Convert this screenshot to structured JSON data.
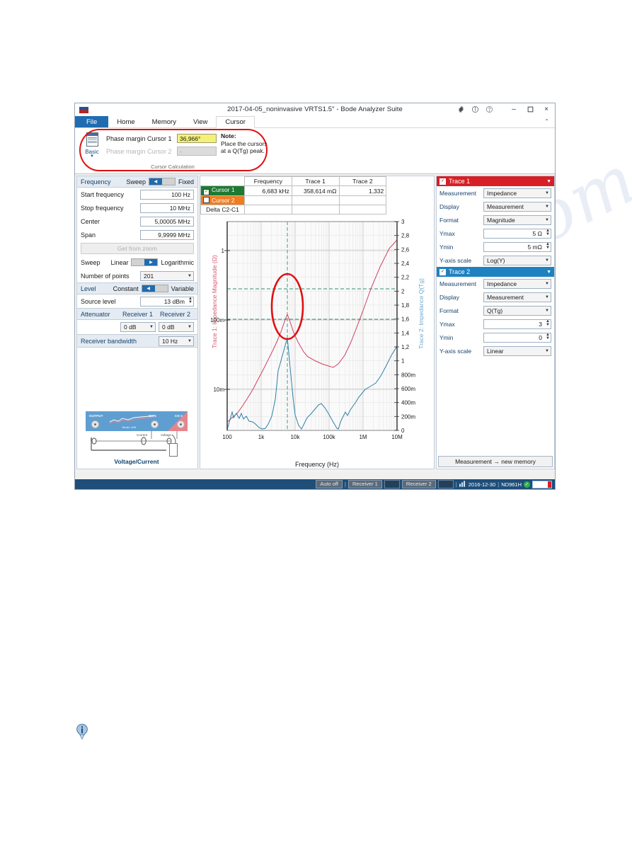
{
  "window": {
    "title": "2017-04-05_noninvasive VRTS1.5\" - Bode Analyzer Suite",
    "icons": {
      "settings": "gear-icon",
      "info": "info-circle-icon",
      "help": "help-circle-icon",
      "minimize": "–",
      "maximize": "❑",
      "close": "×",
      "collapse_ribbon": "⌃"
    }
  },
  "ribbon": {
    "tabs": [
      {
        "label": "File",
        "active": false,
        "style": "file"
      },
      {
        "label": "Home",
        "active": false
      },
      {
        "label": "Memory",
        "active": false
      },
      {
        "label": "View",
        "active": false
      },
      {
        "label": "Cursor",
        "active": true
      }
    ],
    "group": {
      "caption": "Cursor Calculation",
      "basic_label": "Basic",
      "rows": [
        {
          "label": "Phase margin Cursor 1",
          "value": "36,966°",
          "enabled": true
        },
        {
          "label": "Phase margin Cursor 2",
          "value": "-",
          "enabled": false
        }
      ],
      "note_title": "Note:",
      "note_lines": [
        "Place the cursors",
        "at a Q(Tg) peak."
      ]
    }
  },
  "left_panel": {
    "frequency": {
      "title": "Frequency",
      "toggle_left": "Sweep",
      "toggle_right": "Fixed",
      "toggle_position": "left"
    },
    "fields": [
      {
        "label": "Start frequency",
        "value": "100 Hz"
      },
      {
        "label": "Stop frequency",
        "value": "10 MHz"
      },
      {
        "label": "Center",
        "value": "5,00005 MHz"
      },
      {
        "label": "Span",
        "value": "9,9999 MHz"
      }
    ],
    "get_from_zoom": "Get from zoom",
    "sweep": {
      "label": "Sweep",
      "toggle_left": "Linear",
      "toggle_right": "Logarithmic",
      "toggle_position": "right"
    },
    "number_of_points": {
      "label": "Number of points",
      "value": "201"
    },
    "level": {
      "title": "Level",
      "toggle_left": "Constant",
      "toggle_right": "Variable",
      "toggle_position": "left"
    },
    "source_level": {
      "label": "Source level",
      "value": "13 dBm"
    },
    "attenuator": {
      "title": "Attenuator",
      "col1": "Receiver 1",
      "col2": "Receiver 2",
      "value1": "0 dB",
      "value2": "0 dB"
    },
    "receiver_bandwidth": {
      "label": "Receiver bandwidth",
      "value": "10 Hz"
    },
    "circuit": {
      "caption": "Voltage/Current",
      "ports": [
        "OUTPUT",
        "CH 1",
        "CH 2"
      ],
      "brand": "Bode 100",
      "labels": [
        "Current",
        "Voltage"
      ],
      "dut": "DUT"
    }
  },
  "cursor_table": {
    "headers": [
      "",
      "Frequency",
      "Trace 1",
      "Trace 2"
    ],
    "rows": [
      {
        "name": "Cursor 1",
        "checked": true,
        "frequency": "6,683 kHz",
        "trace1": "358,614 mΩ",
        "trace2": "1,332"
      },
      {
        "name": "Cursor 2",
        "checked": false,
        "frequency": "",
        "trace1": "",
        "trace2": ""
      },
      {
        "name": "Delta C2-C1",
        "checked": null,
        "frequency": "",
        "trace1": "",
        "trace2": ""
      }
    ]
  },
  "right_panel": {
    "trace1": {
      "title": "Trace 1",
      "color": "#d81f26",
      "rows": [
        {
          "label": "Measurement",
          "value": "Impedance",
          "type": "combo"
        },
        {
          "label": "Display",
          "value": "Measurement",
          "type": "combo"
        },
        {
          "label": "Format",
          "value": "Magnitude",
          "type": "combo"
        },
        {
          "label": "Ymax",
          "value": "5 Ω",
          "type": "spin"
        },
        {
          "label": "Ymin",
          "value": "5 mΩ",
          "type": "spin"
        },
        {
          "label": "Y-axis scale",
          "value": "Log(Y)",
          "type": "combo"
        }
      ]
    },
    "trace2": {
      "title": "Trace 2",
      "color": "#1f82c0",
      "rows": [
        {
          "label": "Measurement",
          "value": "Impedance",
          "type": "combo"
        },
        {
          "label": "Display",
          "value": "Measurement",
          "type": "combo"
        },
        {
          "label": "Format",
          "value": "Q(Tg)",
          "type": "combo"
        },
        {
          "label": "Ymax",
          "value": "3",
          "type": "spin"
        },
        {
          "label": "Ymin",
          "value": "0",
          "type": "spin"
        },
        {
          "label": "Y-axis scale",
          "value": "Linear",
          "type": "combo"
        }
      ]
    },
    "memory_button": "Measurement → new memory"
  },
  "statusbar": {
    "auto_off": "Auto off",
    "receiver1": "Receiver 1",
    "receiver2": "Receiver 2",
    "date": "2016-12-30",
    "device": "ND961H",
    "check": "✓",
    "chart_icon": "bar-chart-icon"
  },
  "chart_data": {
    "type": "line",
    "title": "",
    "xlabel": "Frequency (Hz)",
    "ylabel": "Trace 1: Impedance Magnitude (Ω)",
    "ylabel_right": "Trace 2: Impedance Q(Tg)",
    "xscale": "log",
    "xlim": [
      100,
      10000000
    ],
    "xticks": [
      100,
      1000,
      10000,
      100000,
      1000000,
      10000000
    ],
    "xticklabels": [
      "100",
      "1k",
      "10k",
      "100k",
      "1M",
      "10M"
    ],
    "left_axis": {
      "scale": "log",
      "ylim": [
        0.005,
        5
      ],
      "ticks": [
        0.01,
        0.1,
        1
      ],
      "ticklabels": [
        "10m",
        "100m",
        "1"
      ],
      "color": "#d4566f"
    },
    "right_axis": {
      "scale": "linear",
      "ylim": [
        0,
        3
      ],
      "ticks": [
        0,
        0.2,
        0.4,
        0.6,
        0.8,
        1,
        1.2,
        1.4,
        1.6,
        1.8,
        2,
        2.2,
        2.4,
        2.6,
        2.8,
        3
      ],
      "ticklabels": [
        "0",
        "200m",
        "400m",
        "600m",
        "800m",
        "1",
        "1,2",
        "1,4",
        "1,6",
        "1,8",
        "2",
        "2,2",
        "2,4",
        "2,6",
        "2,8",
        "3"
      ],
      "color": "#6aa7cf"
    },
    "grid": true,
    "legend": "none",
    "cursor_lines": {
      "vertical_x": 6683,
      "horizontal_left_y": 0.358614,
      "horizontal_right_y": 1.332,
      "color": "#2f8f6f"
    },
    "annotation": {
      "type": "ellipse",
      "color": "#e01010",
      "center_x": 7000,
      "note": "highlight of Q(Tg) peak and magnitude peak"
    },
    "series": [
      {
        "name": "Trace 1: Impedance Magnitude",
        "axis": "left",
        "color": "#cf4060",
        "points": [
          [
            100,
            0.0062
          ],
          [
            140,
            0.0075
          ],
          [
            200,
            0.0088
          ],
          [
            300,
            0.0115
          ],
          [
            450,
            0.0155
          ],
          [
            700,
            0.0225
          ],
          [
            1000,
            0.0315
          ],
          [
            1500,
            0.048
          ],
          [
            2200,
            0.071
          ],
          [
            3200,
            0.105
          ],
          [
            4500,
            0.158
          ],
          [
            5500,
            0.22
          ],
          [
            6200,
            0.29
          ],
          [
            6683,
            0.359
          ],
          [
            7200,
            0.3
          ],
          [
            8200,
            0.215
          ],
          [
            10000,
            0.155
          ],
          [
            14000,
            0.112
          ],
          [
            20000,
            0.093
          ],
          [
            40000,
            0.078
          ],
          [
            80000,
            0.072
          ],
          [
            150000,
            0.068
          ],
          [
            250000,
            0.066
          ],
          [
            400000,
            0.072
          ],
          [
            700000,
            0.1
          ],
          [
            1200000,
            0.17
          ],
          [
            2000000,
            0.3
          ],
          [
            3500000,
            0.62
          ],
          [
            6000000,
            1.25
          ],
          [
            10000000,
            2.2
          ]
        ]
      },
      {
        "name": "Trace 2: Impedance Q(Tg)",
        "axis": "right",
        "color": "#2e7fa8",
        "points": [
          [
            100,
            0.01
          ],
          [
            120,
            0.12
          ],
          [
            150,
            0.26
          ],
          [
            180,
            0.18
          ],
          [
            220,
            0.25
          ],
          [
            280,
            0.17
          ],
          [
            330,
            0.24
          ],
          [
            400,
            0.16
          ],
          [
            500,
            0.2
          ],
          [
            650,
            0.13
          ],
          [
            850,
            0.12
          ],
          [
            1100,
            0.09
          ],
          [
            1500,
            0.04
          ],
          [
            2000,
            0.02
          ],
          [
            2600,
            0.03
          ],
          [
            3300,
            0.09
          ],
          [
            4200,
            0.2
          ],
          [
            5200,
            0.45
          ],
          [
            6000,
            0.85
          ],
          [
            6683,
            1.332
          ],
          [
            7400,
            0.9
          ],
          [
            8500,
            0.48
          ],
          [
            10000,
            0.22
          ],
          [
            13000,
            0.07
          ],
          [
            17000,
            0.02
          ],
          [
            22000,
            0.1
          ],
          [
            30000,
            0.18
          ],
          [
            45000,
            0.24
          ],
          [
            70000,
            0.31
          ],
          [
            110000,
            0.38
          ],
          [
            160000,
            0.39
          ],
          [
            250000,
            0.33
          ],
          [
            400000,
            0.24
          ],
          [
            600000,
            0.14
          ],
          [
            900000,
            0.03
          ],
          [
            1100000,
            0.02
          ],
          [
            1500000,
            0.14
          ],
          [
            2200000,
            0.26
          ],
          [
            2800000,
            0.22
          ],
          [
            3500000,
            0.3
          ],
          [
            5000000,
            0.4
          ],
          [
            7000000,
            0.48
          ],
          [
            10000000,
            0.6
          ]
        ]
      }
    ]
  }
}
